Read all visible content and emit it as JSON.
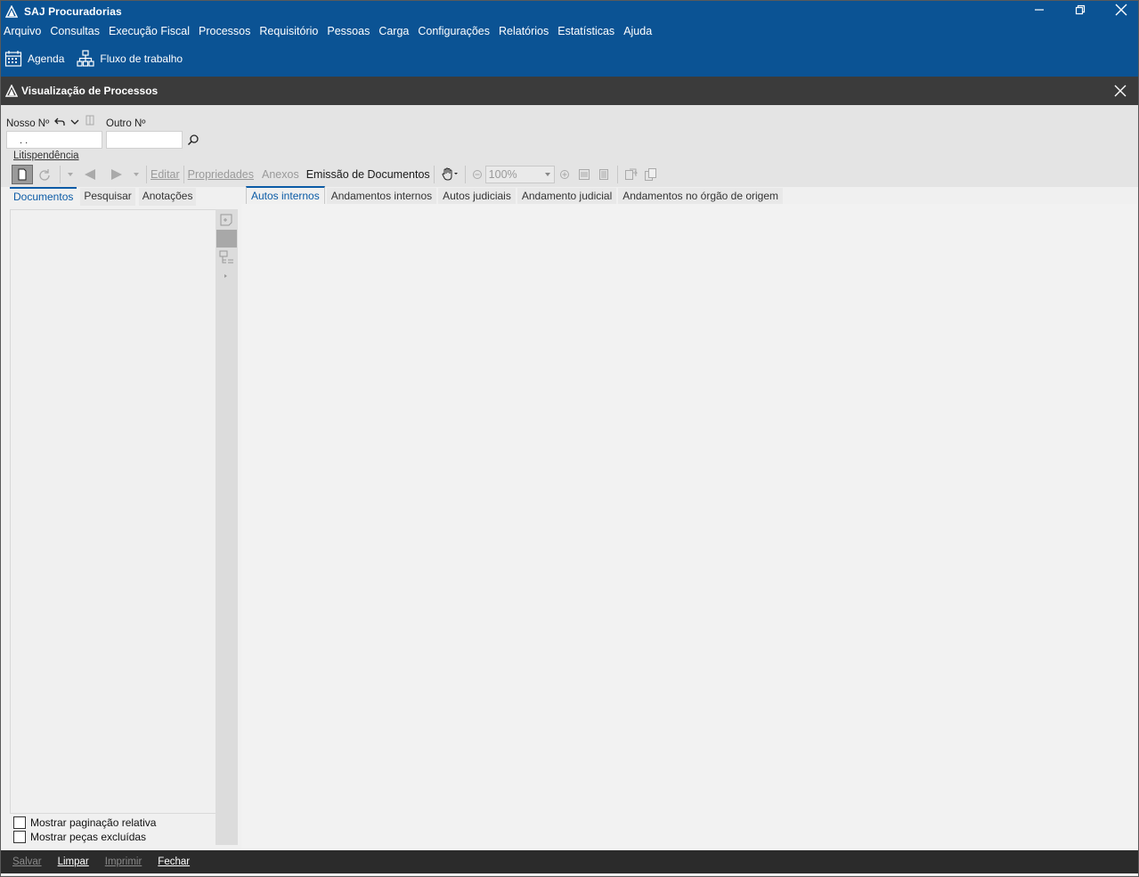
{
  "app": {
    "title": "SAJ Procuradorias"
  },
  "menu": [
    "Arquivo",
    "Consultas",
    "Execução Fiscal",
    "Processos",
    "Requisitório",
    "Pessoas",
    "Carga",
    "Configurações",
    "Relatórios",
    "Estatísticas",
    "Ajuda"
  ],
  "quickbar": {
    "agenda": "Agenda",
    "fluxo": "Fluxo de trabalho"
  },
  "window": {
    "title": "Visualização de Processos"
  },
  "form": {
    "nosso_label": "Nosso Nº",
    "nosso_value": ". .",
    "outro_label": "Outro Nº",
    "outro_value": "",
    "litis": "Litispendência"
  },
  "doc_toolbar": {
    "editar": "Editar",
    "propriedades": "Propriedades",
    "anexos": "Anexos",
    "emissao": "Emissão de Documentos",
    "zoom": "100%"
  },
  "left_tabs": [
    "Documentos",
    "Pesquisar",
    "Anotações"
  ],
  "right_tabs": [
    "Autos internos",
    "Andamentos internos",
    "Autos judiciais",
    "Andamento judicial",
    "Andamentos no órgão de origem"
  ],
  "options": {
    "paginacao": "Mostrar paginação relativa",
    "excluidas": "Mostrar peças excluídas"
  },
  "footer": {
    "salvar": "Salvar",
    "limpar": "Limpar",
    "imprimir": "Imprimir",
    "fechar": "Fechar"
  },
  "colors": {
    "brand": "#0b5394",
    "tab_accent": "#0b5ba6",
    "dark_header": "#3b3b3b"
  }
}
